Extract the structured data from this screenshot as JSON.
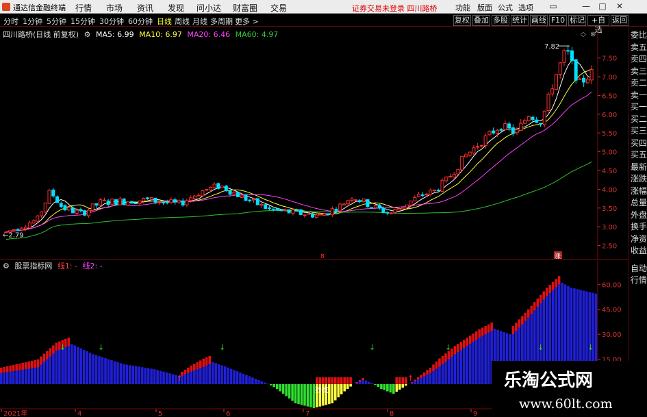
{
  "menubar": {
    "app_title": "通达信金融终端",
    "items": [
      "行情",
      "市场",
      "资讯",
      "发现",
      "问小达",
      "财富圈",
      "交易"
    ],
    "notice": "证券交易未登录  四川路桥",
    "right_items": [
      "功能",
      "版面",
      "公式",
      "选项"
    ],
    "window_buttons": [
      "▭",
      "—",
      "□",
      "✕"
    ]
  },
  "toolbar": {
    "periods": [
      "分时",
      "1分钟",
      "5分钟",
      "15分钟",
      "30分钟",
      "60分钟",
      "日线",
      "周线",
      "月线",
      "多周期",
      "更多 >"
    ],
    "active_period": "日线",
    "buttons": [
      "复权",
      "叠加",
      "多股",
      "统计",
      "画线",
      "F10",
      "标记",
      "+自选",
      "返回"
    ]
  },
  "main_chart": {
    "stock_label": "四川路桥(日线 前复权)",
    "ma5": "MA5: 6.99",
    "ma10": "MA10: 6.97",
    "ma20": "MA20: 6.46",
    "ma60": "MA60: 4.97",
    "high_marker": "7.82",
    "low_marker": "2.79",
    "y_ticks": [
      "7.50",
      "7.00",
      "6.50",
      "6.00",
      "5.50",
      "5.00",
      "4.50",
      "4.00",
      "3.50",
      "3.00",
      "2.50"
    ],
    "y_min": 2.2,
    "y_max": 7.95,
    "mid_markers": [
      "8",
      "涨"
    ]
  },
  "sub_chart": {
    "indicator_label": "股票指标网",
    "line1": "线1: -",
    "line2": "线2: -",
    "y_ticks": [
      "60.00",
      "45.00",
      "30.00",
      "15.00"
    ],
    "y_min": -10,
    "y_max": 70,
    "annotation": "抄底",
    "x_labels": [
      "2021年",
      "4",
      "5",
      "6",
      "7",
      "8",
      "9"
    ]
  },
  "side_panel": {
    "items": [
      "委比",
      "卖五",
      "卖四",
      "卖三",
      "卖二",
      "卖一",
      "买一",
      "买二",
      "买三",
      "买四",
      "买五",
      "最新",
      "涨跌",
      "涨幅",
      "总量",
      "外盘",
      "换手",
      "净资",
      "收益"
    ],
    "sub_items": [
      "自动",
      "行情"
    ]
  },
  "colors": {
    "up": "#ff3030",
    "down": "#00e0ff",
    "ma5": "#ffffff",
    "ma10": "#ffff40",
    "ma20": "#ff40ff",
    "ma60": "#30c030",
    "bar_blue": "#2020d8",
    "bar_red": "#e01010",
    "bar_yellow": "#ffff40",
    "bar_green": "#30e030",
    "arrow_green": "#20e020",
    "arrow_red": "#ff2020"
  },
  "watermark": {
    "title": "乐淘公式网",
    "url": "www.60lt.com"
  }
}
